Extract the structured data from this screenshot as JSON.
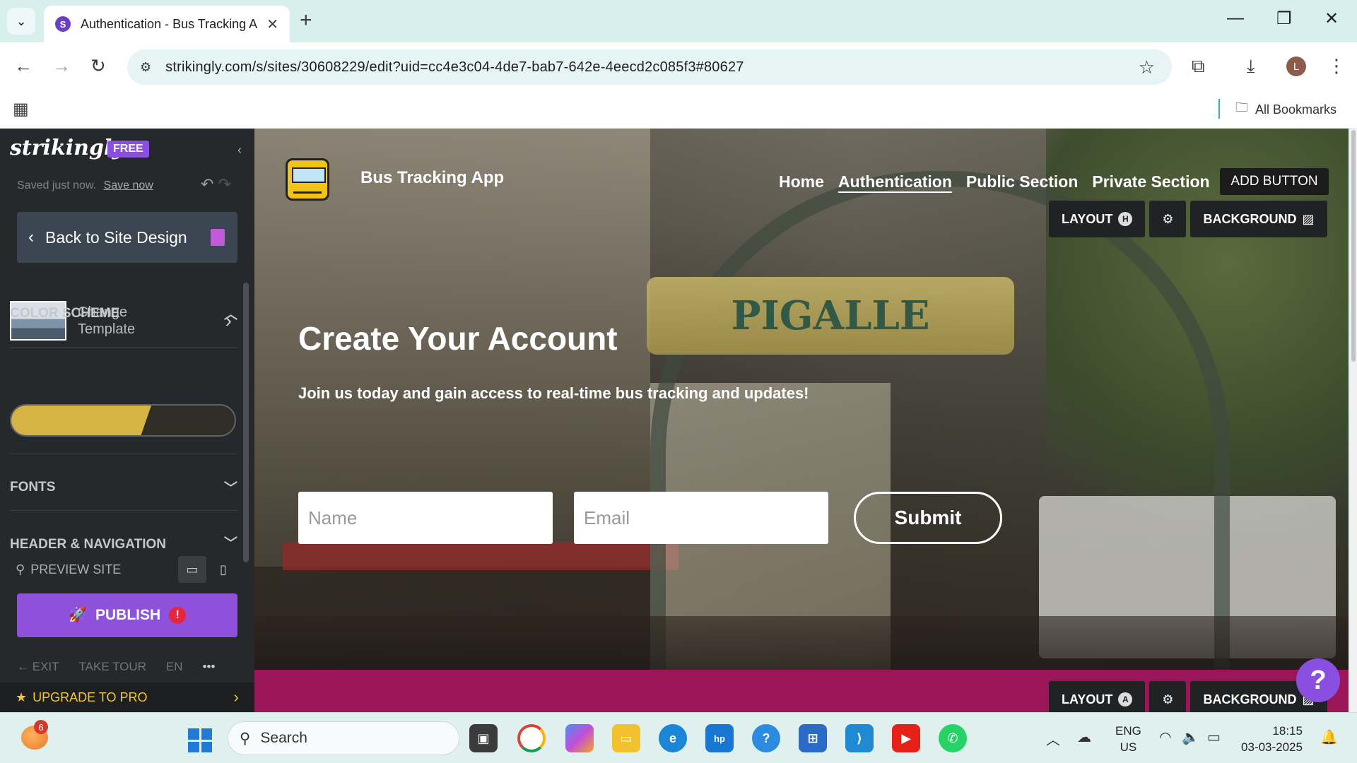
{
  "browser": {
    "tab_title": "Authentication - Bus Tracking App",
    "tab_favicon_letter": "S",
    "url": "strikingly.com/s/sites/30608229/edit?uid=cc4e3c04-4de7-bab7-642e-4eecd2c085f3#80627",
    "profile_initial": "L",
    "bookmarks_label": "All Bookmarks"
  },
  "sidebar": {
    "logo": "strikingly",
    "plan_badge": "FREE",
    "saved_status": "Saved just now.",
    "save_now": "Save now",
    "back_label": "Back to Site Design",
    "change_template_label": "Change Template",
    "color_scheme_label": "COLOR SCHEME",
    "color_scheme_colors": [
      "#d5b443",
      "#2f2d25"
    ],
    "fonts_label": "FONTS",
    "header_nav_label": "HEADER & NAVIGATION",
    "preview_label": "PREVIEW SITE",
    "publish_label": "PUBLISH",
    "publish_alert": "!",
    "exit_label": "EXIT",
    "tour_label": "TAKE TOUR",
    "lang_label": "EN",
    "more_label": "•••",
    "upgrade_label": "UPGRADE TO PRO"
  },
  "site": {
    "name": "Bus Tracking App",
    "nav": [
      "Home",
      "Authentication",
      "Public Section",
      "Private Section"
    ],
    "active_nav": "Authentication",
    "add_button": "ADD BUTTON",
    "layout_label": "LAYOUT",
    "layout_tag_top": "H",
    "layout_tag_bottom": "A",
    "background_label": "BACKGROUND",
    "sign_text": "PIGALLE",
    "hero_title": "Create Your Account",
    "hero_subtitle": "Join us today and gain access to real-time bus tracking and updates!",
    "name_placeholder": "Name",
    "email_placeholder": "Email",
    "submit_label": "Submit",
    "help_label": "?",
    "next_section_color": "#9b1559"
  },
  "taskbar": {
    "weather_badge": "6",
    "search_label": "Search",
    "language": "ENG",
    "region": "US",
    "time": "18:15",
    "date": "03-03-2025"
  }
}
